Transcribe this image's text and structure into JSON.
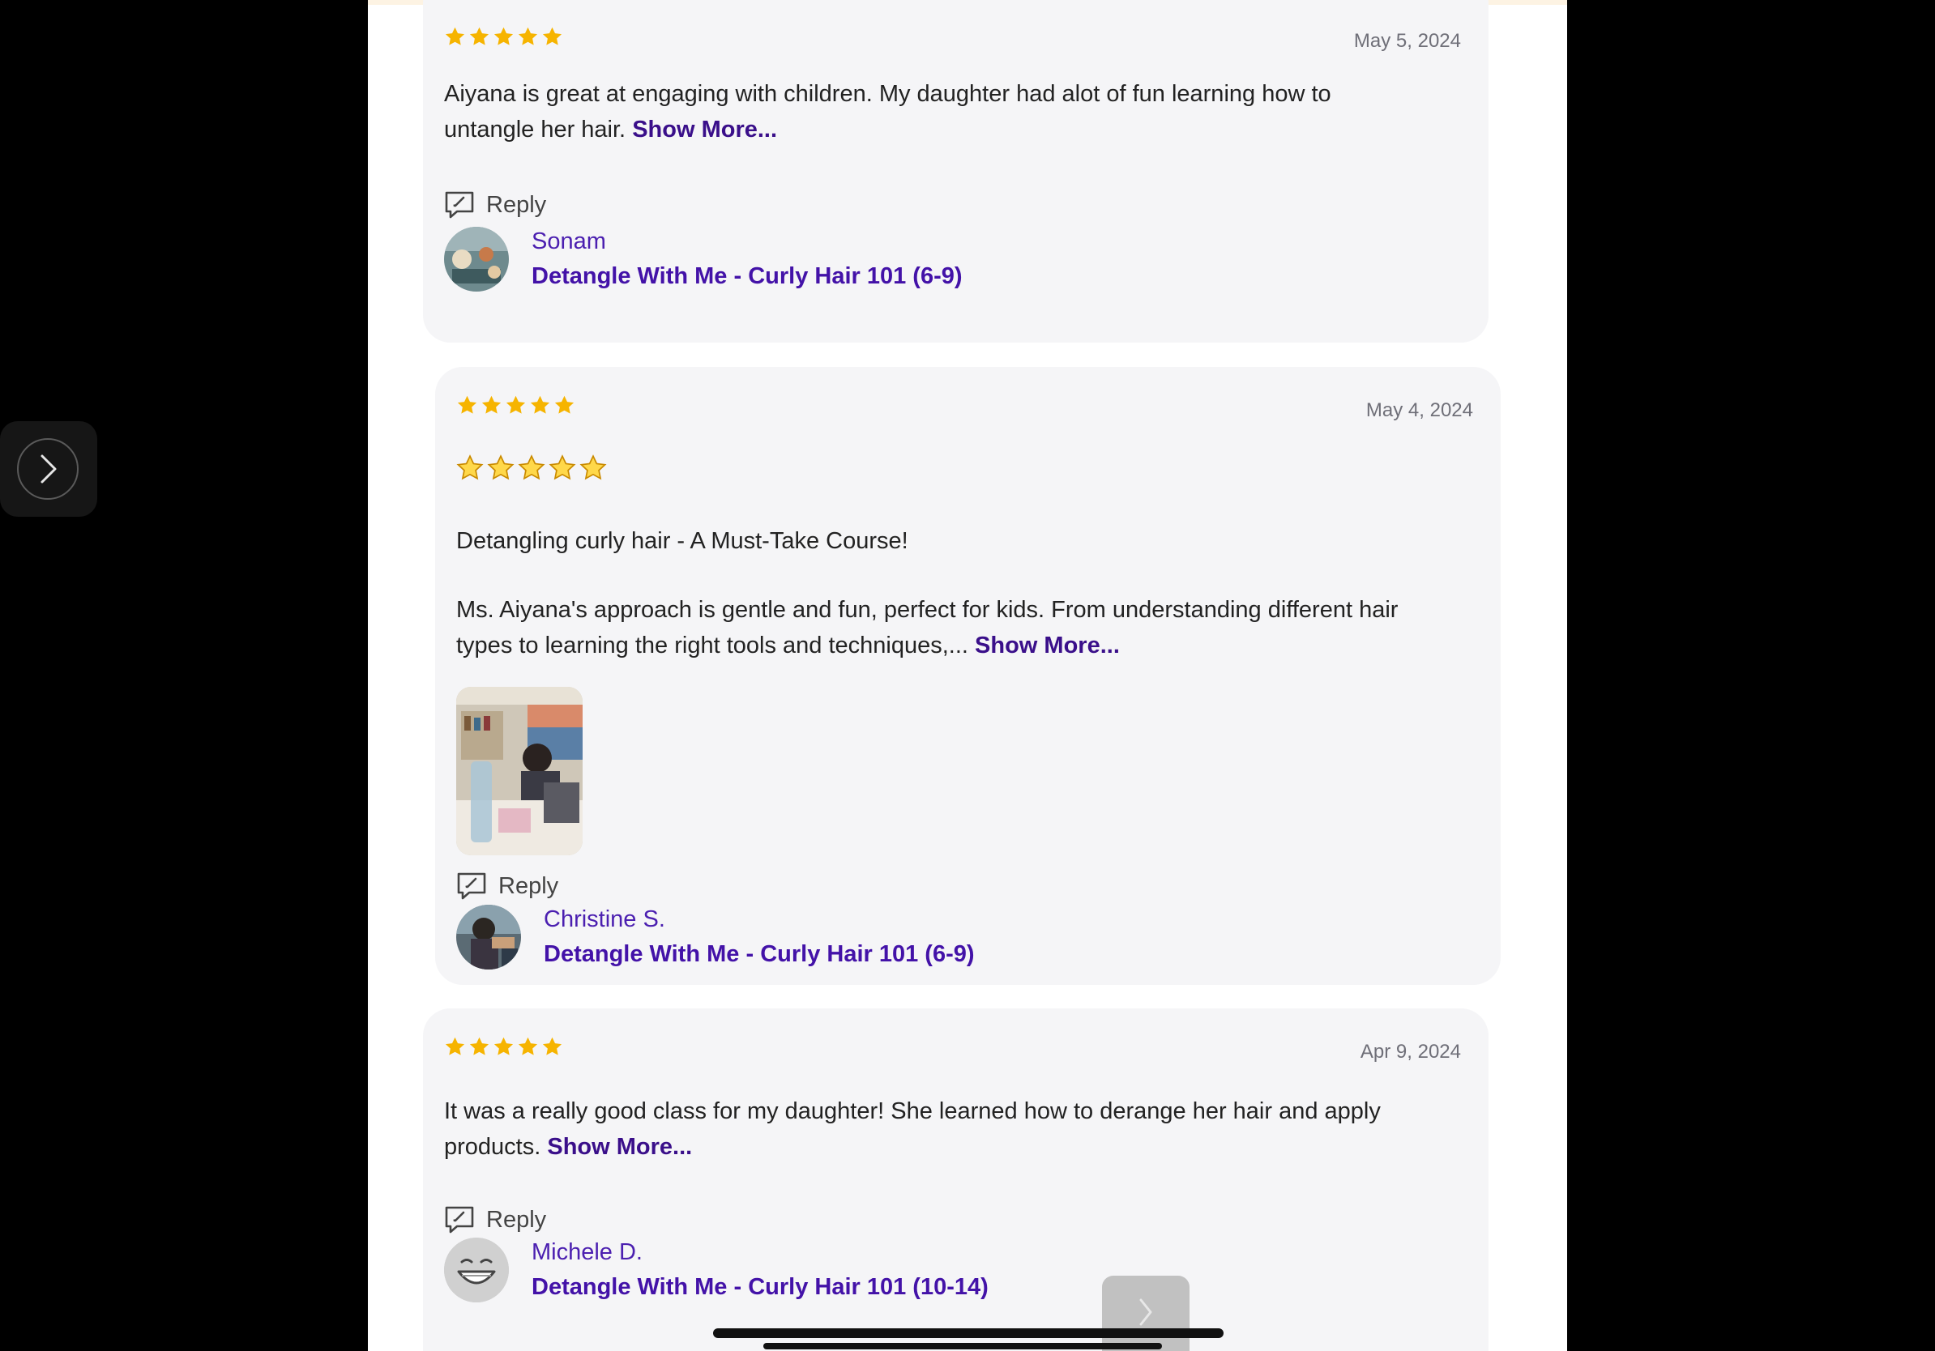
{
  "reviews": [
    {
      "date": "May 5, 2024",
      "rating": 5,
      "text": "Aiyana is great at engaging with children. My daughter had alot of fun learning how to untangle her hair.",
      "show_more": "Show More...",
      "reply_label": "Reply",
      "author": "Sonam",
      "course": "Detangle With Me - Curly Hair 101 (6-9)"
    },
    {
      "date": "May 4, 2024",
      "rating": 5,
      "title": "Detangling curly hair - A Must-Take Course!",
      "text": "Ms. Aiyana's approach is gentle and fun, perfect for kids. From understanding different hair types to learning the right tools and techniques,...",
      "show_more": "Show More...",
      "reply_label": "Reply",
      "author": "Christine S.",
      "course": "Detangle With Me - Curly Hair 101 (6-9)"
    },
    {
      "date": "Apr 9, 2024",
      "rating": 5,
      "text": "It was a really good class for my daughter! She learned how to derange her hair and apply products.",
      "show_more": "Show More...",
      "reply_label": "Reply",
      "author": "Michele D.",
      "course": "Detangle With Me - Curly Hair 101 (10-14)"
    }
  ],
  "colors": {
    "star": "#f6b400",
    "link": "#3a0f8a",
    "author": "#4b1fb0",
    "card_bg": "#f5f5f7"
  },
  "icons": {
    "side_nav": "chevron-right-icon",
    "reply": "reply-bubble-icon",
    "menu": "more-dots-icon"
  }
}
